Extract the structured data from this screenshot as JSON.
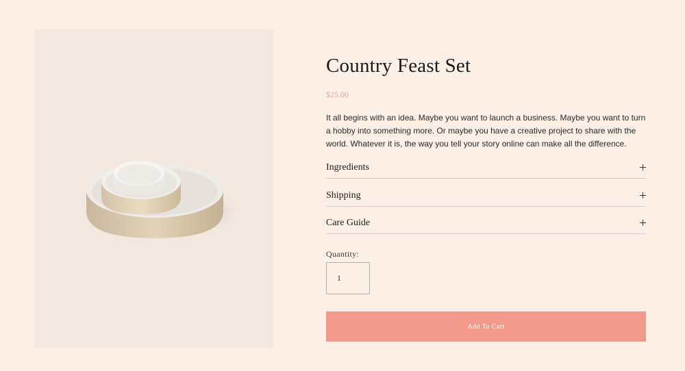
{
  "product": {
    "title": "Country Feast Set",
    "price": "$25.00",
    "description": "It all begins with an idea. Maybe you want to launch a business. Maybe you want to turn a hobby into something more. Or maybe you have a creative project to share with the world. Whatever it is, the way you tell your story online can make all the difference."
  },
  "accordion": {
    "items": [
      {
        "label": "Ingredients"
      },
      {
        "label": "Shipping"
      },
      {
        "label": "Care Guide"
      }
    ]
  },
  "purchase": {
    "quantity_label": "Quantity:",
    "quantity_value": "1",
    "add_to_cart_label": "Add To Cart"
  },
  "colors": {
    "background": "#fcefe6",
    "image_background": "#f3e8e0",
    "price": "#e8a28f",
    "button": "#f19a8b"
  }
}
